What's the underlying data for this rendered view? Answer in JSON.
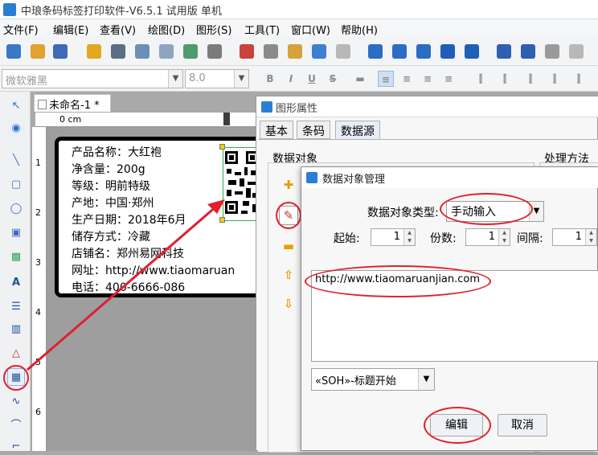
{
  "window": {
    "title": "中琅条码标签打印软件-V6.5.1 试用版 单机"
  },
  "menu": [
    "文件(F)",
    "编辑(E)",
    "查看(V)",
    "绘图(D)",
    "图形(S)",
    "工具(T)",
    "窗口(W)",
    "帮助(H)"
  ],
  "format_bar": {
    "font_name": "微软雅黑",
    "font_size": "8.0",
    "bold": "B",
    "italic": "I",
    "underline": "U",
    "strike": "S"
  },
  "document": {
    "tab_title": "未命名-1 *",
    "ruler_zero": "0 cm",
    "ruler_v_labels": [
      "1",
      "2",
      "3",
      "4",
      "5",
      "6"
    ]
  },
  "label": {
    "lines": [
      "产品名称：大红袍",
      "净含量：200g",
      "等级：明前特级",
      "产地：中国·郑州",
      "生产日期：2018年6月",
      "储存方式：冷藏",
      "店铺名：郑州易网科技",
      "网址：http://www.tiaomaruan",
      "电话：400-6666-086"
    ]
  },
  "shape_dialog": {
    "title": "图形属性",
    "tabs": [
      "基本",
      "条码",
      "数据源"
    ],
    "active_tab": "数据源",
    "group_title": "数据对象",
    "processing_title": "处理方法"
  },
  "data_dialog": {
    "title": "数据对象管理",
    "type_label": "数据对象类型:",
    "type_value": "手动输入",
    "start_label": "起始:",
    "start_value": "1",
    "count_label": "份数:",
    "count_value": "1",
    "interval_label": "间隔:",
    "interval_value": "1",
    "content": "http://www.tiaomaruanjian.com",
    "insert_value": "«SOH»-标题开始",
    "edit_button": "编辑",
    "cancel_button": "取消"
  },
  "colors": {
    "annotation": "#e0202e",
    "accent": "#2a7fd4",
    "tab_active": "#e7eef8"
  }
}
